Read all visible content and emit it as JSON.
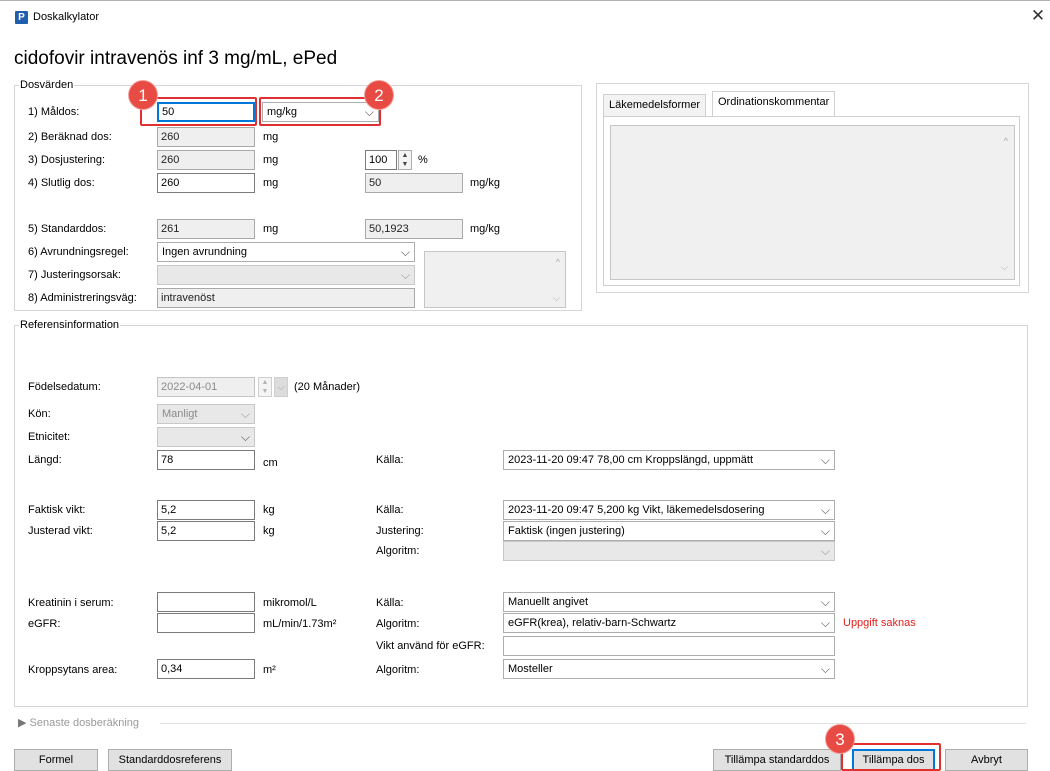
{
  "window": {
    "icon_letter": "P",
    "title": "Doskalkylator",
    "close_glyph": "✕"
  },
  "drug_title": "cidofovir intravenös inf 3 mg/mL, ePed",
  "dosvarden": {
    "legend": "Dosvärden",
    "maldos": {
      "label": "1) Måldos:",
      "value": "50",
      "unit_select": "mg/kg"
    },
    "beraknad": {
      "label": "2) Beräknad dos:",
      "value": "260",
      "unit": "mg"
    },
    "dosjustering": {
      "label": "3) Dosjustering:",
      "value": "260",
      "unit": "mg",
      "percent": "100",
      "percent_unit": "%"
    },
    "slutlig": {
      "label": "4) Slutlig dos:",
      "value": "260",
      "unit": "mg",
      "per_kg": "50",
      "per_kg_unit": "mg/kg"
    },
    "standarddos": {
      "label": "5) Standarddos:",
      "value": "261",
      "unit": "mg",
      "per_kg": "50,1923",
      "per_kg_unit": "mg/kg"
    },
    "avrundning": {
      "label": "6) Avrundningsregel:",
      "value": "Ingen avrundning"
    },
    "justeringsorsak": {
      "label": "7) Justeringsorsak:",
      "value": ""
    },
    "administreringsvag": {
      "label": "8) Administreringsväg:",
      "value": "intravenöst"
    }
  },
  "tabs": [
    {
      "label": "Läkemedelsformer"
    },
    {
      "label": "Ordinationskommentar"
    }
  ],
  "ref": {
    "legend": "Referensinformation",
    "fodelsedatum": {
      "label": "Födelsedatum:",
      "value": "2022-04-01",
      "age": "(20 Månader)"
    },
    "kon": {
      "label": "Kön:",
      "value": "Manligt"
    },
    "etnicitet": {
      "label": "Etnicitet:",
      "value": ""
    },
    "langd": {
      "label": "Längd:",
      "value": "78",
      "unit": "cm",
      "kalla_label": "Källa:",
      "kalla_value": "2023-11-20 09:47  78,00 cm Kroppslängd, uppmätt"
    },
    "faktisk_vikt": {
      "label": "Faktisk vikt:",
      "value": "5,2",
      "unit": "kg",
      "kalla_label": "Källa:",
      "kalla_value": "2023-11-20 09:47  5,200 kg Vikt, läkemedelsdosering"
    },
    "justerad_vikt": {
      "label": "Justerad vikt:",
      "value": "5,2",
      "unit": "kg",
      "justering_label": "Justering:",
      "justering_value": "Faktisk (ingen justering)",
      "algoritm_label": "Algoritm:",
      "algoritm_value": ""
    },
    "kreatinin": {
      "label": "Kreatinin i serum:",
      "value": "",
      "unit": "mikromol/L",
      "kalla_label": "Källa:",
      "kalla_value": "Manuellt angivet"
    },
    "egfr": {
      "label": "eGFR:",
      "value": "",
      "unit": "mL/min/1.73m²",
      "algoritm_label": "Algoritm:",
      "algoritm_value": "eGFR(krea), relativ-barn-Schwartz",
      "warning": "Uppgift saknas"
    },
    "vikt_egfr": {
      "label": "Vikt använd för eGFR:",
      "value": ""
    },
    "kroppsyta": {
      "label": "Kroppsytans area:",
      "value": "0,34",
      "unit": "m²",
      "algoritm_label": "Algoritm:",
      "algoritm_value": "Mosteller"
    }
  },
  "senaste": {
    "label": "Senaste dosberäkning"
  },
  "buttons": {
    "formel": "Formel",
    "standarddosreferens": "Standarddosreferens",
    "tillampa_standarddos": "Tillämpa standarddos",
    "tillampa_dos": "Tillämpa dos",
    "avbryt": "Avbryt"
  },
  "annotations": [
    "1",
    "2",
    "3"
  ],
  "colors": {
    "highlight": "#e03030",
    "badge": "#e84b43",
    "warning": "#e0201c",
    "focus": "#0078d7"
  }
}
